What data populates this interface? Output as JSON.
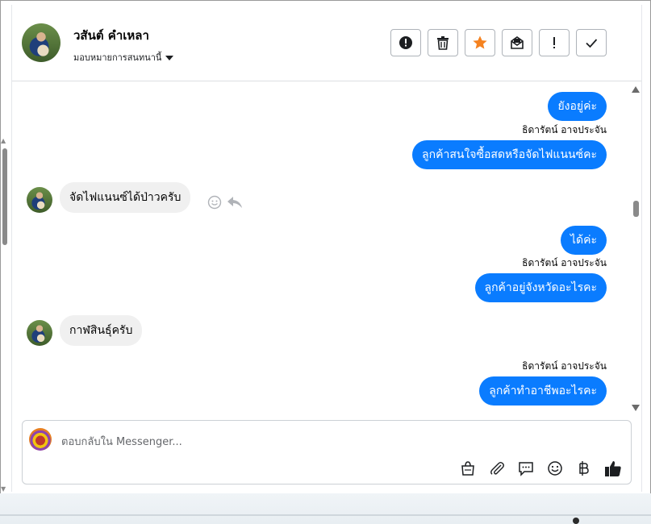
{
  "header": {
    "contact_name": "วสันต์ คำเหลา",
    "assign_label": "มอบหมายการสนทนานี้"
  },
  "toolbar": {
    "buttons": [
      {
        "name": "mark-spam",
        "icon": "alert-circle-icon"
      },
      {
        "name": "delete",
        "icon": "trash-icon"
      },
      {
        "name": "star",
        "icon": "star-icon",
        "color": "#f5821f"
      },
      {
        "name": "mark-unread",
        "icon": "mail-open-icon"
      },
      {
        "name": "follow-up",
        "icon": "exclamation-icon"
      },
      {
        "name": "mark-done",
        "icon": "check-icon"
      }
    ]
  },
  "messages": [
    {
      "dir": "out",
      "text": "ยังอยู่ค่ะ"
    },
    {
      "dir": "out",
      "sender": "ธิดารัตน์ อาจประจัน",
      "text": "ลูกค้าสนใจซื้อสดหรือจัดไฟแนนซ์คะ"
    },
    {
      "dir": "in",
      "text": "จัดไฟแนนซ์ได้ป่าวครับ"
    },
    {
      "dir": "out",
      "text": "ได้ค่ะ"
    },
    {
      "dir": "out",
      "sender": "ธิดารัตน์ อาจประจัน",
      "text": "ลูกค้าอยู่จังหวัดอะไรคะ"
    },
    {
      "dir": "in",
      "text": "กาฬสินธุ์ครับ"
    },
    {
      "dir": "out",
      "sender": "ธิดารัตน์ อาจประจัน",
      "text": "ลูกค้าทำอาชีพอะไรคะ"
    }
  ],
  "composer": {
    "placeholder": "ตอบกลับใน Messenger...",
    "tools": [
      "shop-bag-icon",
      "paperclip-icon",
      "saved-reply-icon",
      "emoji-icon",
      "baht-icon",
      "thumbs-up-icon"
    ]
  },
  "colors": {
    "outgoing_bubble": "#0a7cff",
    "incoming_bubble": "#f0f0f0",
    "star_accent": "#f5821f"
  }
}
